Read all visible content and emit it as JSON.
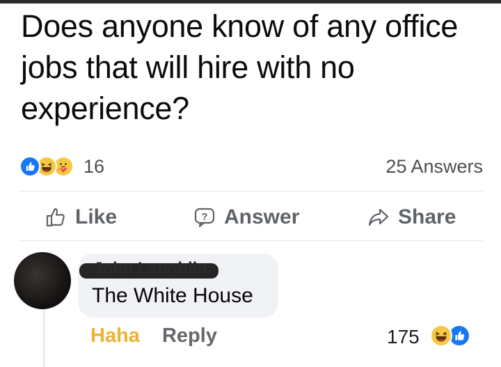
{
  "post": {
    "question": "Does anyone know of any office jobs that will hire with no experience?",
    "reaction_icons": [
      "like-icon",
      "haha-icon",
      "care-icon"
    ],
    "reaction_count": "16",
    "answers_count": "25 Answers"
  },
  "actions": {
    "like_label": "Like",
    "answer_label": "Answer",
    "share_label": "Share"
  },
  "comment": {
    "author": "John Laughlin",
    "text": "The White House",
    "haha_label": "Haha",
    "reply_label": "Reply",
    "reaction_count": "175",
    "reaction_icons": [
      "haha-icon",
      "like-icon"
    ]
  },
  "colors": {
    "like_blue": "#1877f2",
    "haha_yellow": "#f7c844",
    "haha_label": "#f0b234",
    "muted_text": "#65676b"
  }
}
